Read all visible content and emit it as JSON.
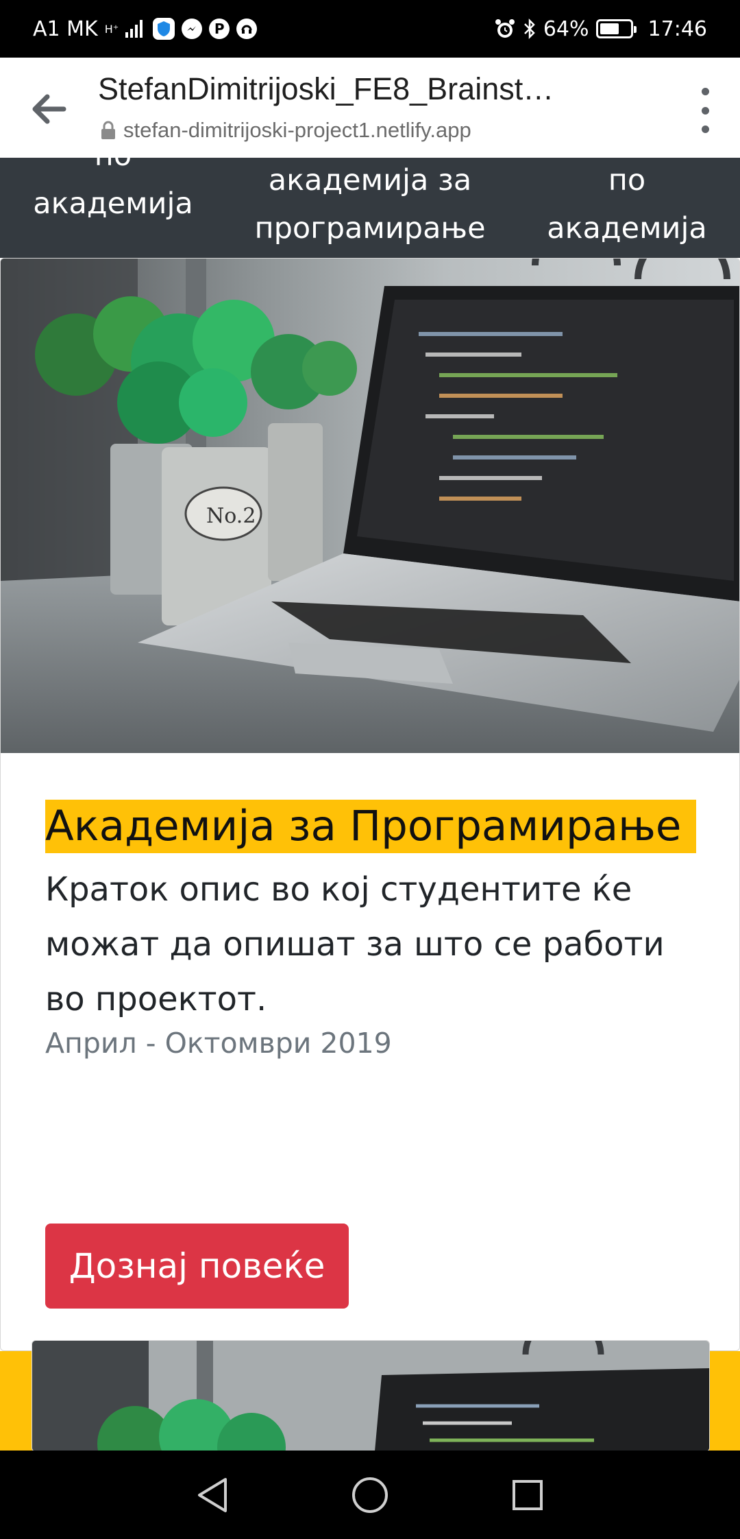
{
  "status_bar": {
    "carrier": "A1 MK",
    "network": "H⁺",
    "battery_percent": "64%",
    "time": "17:46",
    "battery_level": 0.64
  },
  "browser": {
    "title": "StefanDimitrijoski_FE8_Brainst…",
    "url": "stefan-dimitrijoski-project1.netlify.app"
  },
  "nav_strip": {
    "items": [
      {
        "lines": [
          "по",
          "академија"
        ]
      },
      {
        "lines": [
          "академија за",
          "програмирање"
        ]
      },
      {
        "lines": [
          "по",
          "академија"
        ]
      }
    ]
  },
  "card": {
    "title": "Академија за Програмирање",
    "text": "Краток опис во кој студентите ќе можат да опишат за што се работи во проектот.",
    "date": "Април - Октомври 2019",
    "button_label": "Дознај повеќе"
  },
  "colors": {
    "accent_yellow": "#ffc107",
    "button_red": "#dc3545",
    "nav_dark": "#343a40"
  }
}
